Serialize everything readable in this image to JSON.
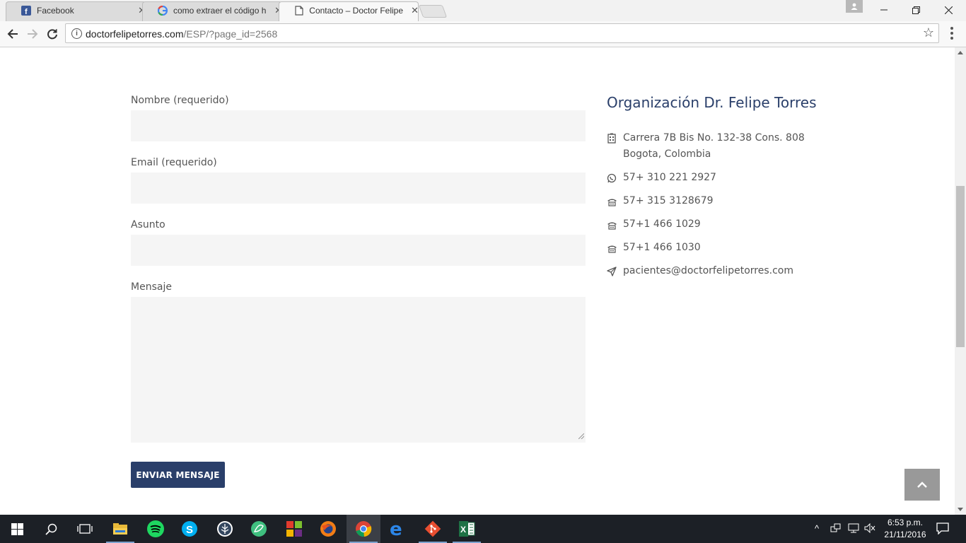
{
  "browser": {
    "tabs": [
      {
        "label": "Facebook",
        "icon": "facebook-icon"
      },
      {
        "label": "como extraer el código h",
        "icon": "google-icon"
      },
      {
        "label": "Contacto – Doctor Felipe",
        "icon": "page-icon",
        "active": true
      }
    ],
    "url_domain": "doctorfelipetorres.com",
    "url_path": "/ESP/?page_id=2568"
  },
  "form": {
    "name_label": "Nombre (requerido)",
    "email_label": "Email (requerido)",
    "subject_label": "Asunto",
    "message_label": "Mensaje",
    "name_value": "",
    "email_value": "",
    "subject_value": "",
    "message_value": "",
    "submit_label": "ENVIAR MENSAJE"
  },
  "contact": {
    "title": "Organización Dr. Felipe Torres",
    "address_line1": "Carrera 7B Bis No. 132-38 Cons. 808",
    "address_line2": "Bogota, Colombia",
    "whatsapp": "57+ 310 221 2927",
    "phone1": "57+ 315 3128679",
    "phone2": "57+1 466 1029",
    "phone3": "57+1 466 1030",
    "email": "pacientes@doctorfelipetorres.com"
  },
  "taskbar": {
    "time": "6:53 p.m.",
    "date": "21/11/2016"
  },
  "colors": {
    "accent": "#2a3f6a",
    "input_bg": "#f5f5f5",
    "back_to_top": "#999999"
  }
}
